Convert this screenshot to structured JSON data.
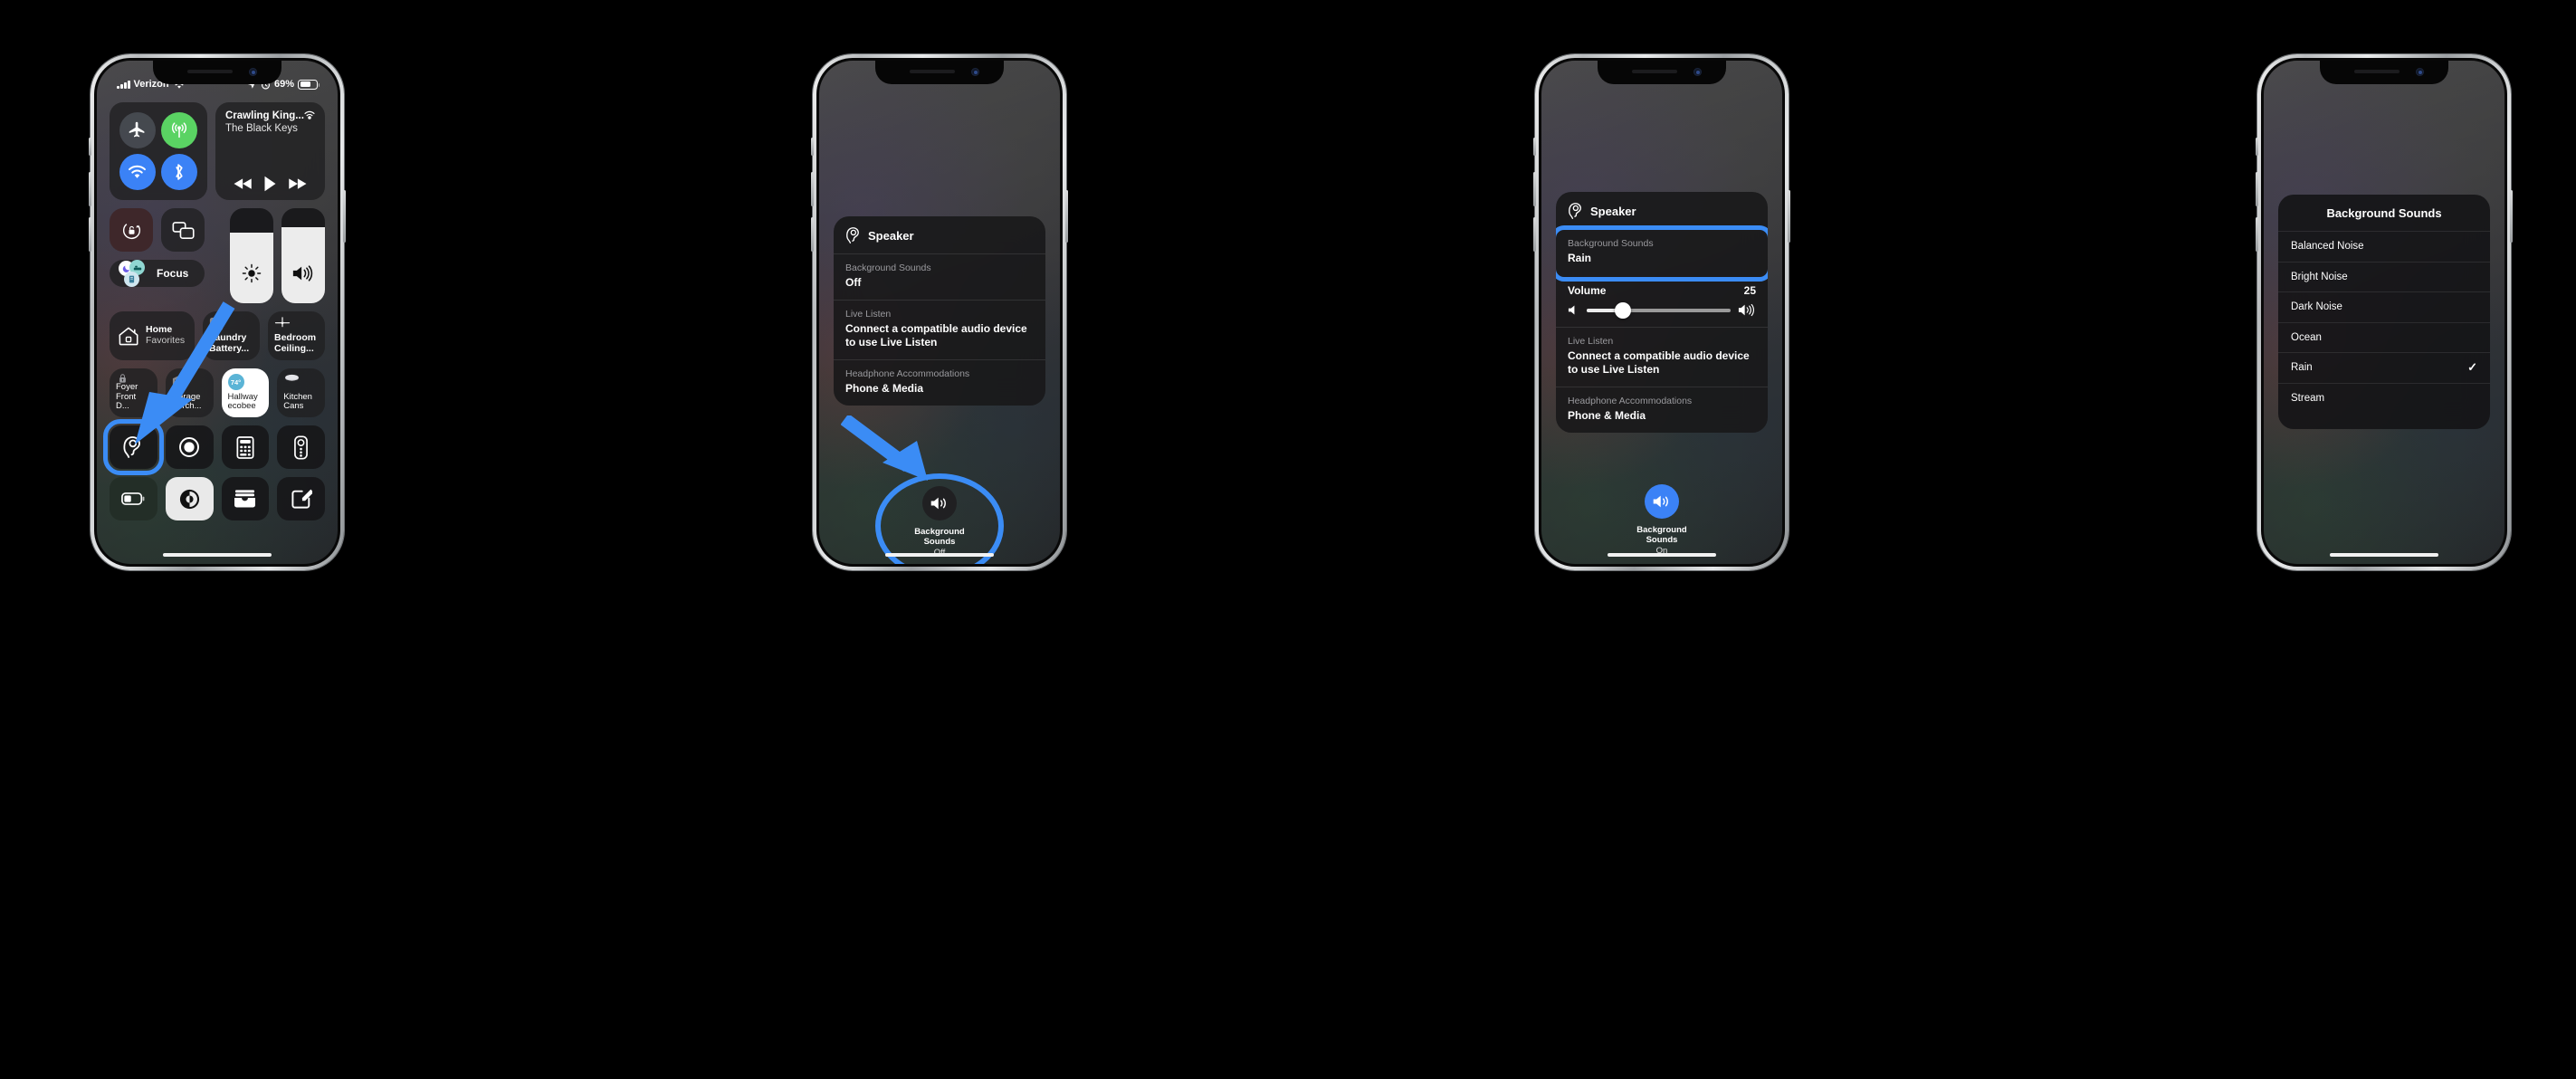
{
  "accent_blue": "#3b8cf5",
  "phone1": {
    "status_bar": {
      "carrier": "Verizon",
      "battery_percent": "69%",
      "icons": [
        "signal-bars-icon",
        "wifi-icon",
        "location-arrow-icon",
        "alarm-clock-icon",
        "battery-icon"
      ]
    },
    "connectivity": {
      "airplane_mode": "airplane-icon",
      "cellular_data": "cellular-data-icon",
      "wifi": "wifi-icon",
      "bluetooth": "bluetooth-icon"
    },
    "now_playing": {
      "title": "Crawling King...",
      "artist": "The Black Keys",
      "airplay": "airplay-audio-icon",
      "controls": [
        "rewind-icon",
        "play-icon",
        "fast-forward-icon"
      ]
    },
    "toggles": {
      "rotation_lock": "rotation-lock-icon",
      "screen_mirroring": "screen-mirroring-icon",
      "focus_label": "Focus",
      "brightness": "brightness-icon",
      "volume": "volume-icon"
    },
    "home_tiles": [
      {
        "title": "Home",
        "subtitle": "Favorites",
        "icon": "home-icon"
      },
      {
        "title": "Laundry",
        "subtitle": "Battery...",
        "icon": "outlet-icon"
      },
      {
        "title": "Bedroom",
        "subtitle": "Ceiling...",
        "icon": "ceiling-fan-icon"
      }
    ],
    "accessories": [
      {
        "name_line1": "Foyer",
        "name_line2": "Front D...",
        "icon": "lock-icon",
        "lit": false
      },
      {
        "name_line1": "Garage",
        "name_line2": "Perch...",
        "icon": "garage-door-icon",
        "lit": false
      },
      {
        "name_line1": "Hallway",
        "name_line2": "ecobee",
        "icon": "thermostat-icon",
        "lit": true,
        "temperature": "74°"
      },
      {
        "name_line1": "Kitchen",
        "name_line2": "Cans",
        "icon": "ceiling-light-icon",
        "lit": false
      }
    ],
    "tiles_row1": [
      {
        "icon": "hearing-ear-icon",
        "highlighted": true
      },
      {
        "icon": "screen-record-icon",
        "highlighted": false
      },
      {
        "icon": "calculator-icon",
        "highlighted": false
      },
      {
        "icon": "apple-tv-remote-icon",
        "highlighted": false
      }
    ],
    "tiles_row2": [
      {
        "icon": "low-power-mode-icon",
        "style": "greenish"
      },
      {
        "icon": "dark-mode-icon",
        "style": "white"
      },
      {
        "icon": "wallet-icon",
        "style": "dark"
      },
      {
        "icon": "notes-icon",
        "style": "dark"
      }
    ],
    "annotation": {
      "arrow": "arrow-pointing-to-hearing-tile"
    }
  },
  "phone2": {
    "panel": {
      "header_icon": "hearing-ear-icon",
      "header_title": "Speaker",
      "rows": [
        {
          "label": "Background Sounds",
          "value": "Off",
          "highlighted": false
        },
        {
          "label": "Live Listen",
          "value": "Connect a compatible audio device to use Live Listen",
          "highlighted": false
        },
        {
          "label": "Headphone Accommodations",
          "value": "Phone & Media",
          "highlighted": false
        }
      ]
    },
    "bottom_control": {
      "icon": "speaker-waves-icon",
      "caption_line1": "Background",
      "caption_line2": "Sounds",
      "state": "Off",
      "highlighted": true,
      "knob_style": "dark"
    },
    "annotation": {
      "arrow": "arrow-pointing-to-background-sounds-button"
    }
  },
  "phone3": {
    "panel": {
      "header_icon": "hearing-ear-icon",
      "header_title": "Speaker",
      "rows": [
        {
          "label": "Background Sounds",
          "value": "Rain",
          "highlighted": true
        },
        {
          "label": "Live Listen",
          "value": "Connect a compatible audio device to use Live Listen",
          "highlighted": false
        },
        {
          "label": "Headphone Accommodations",
          "value": "Phone & Media",
          "highlighted": false
        }
      ],
      "volume": {
        "label": "Volume",
        "value": "25",
        "percent": 25,
        "icon_low": "speaker-low-icon",
        "icon_high": "speaker-high-icon"
      }
    },
    "bottom_control": {
      "icon": "speaker-waves-icon",
      "caption_line1": "Background",
      "caption_line2": "Sounds",
      "state": "On",
      "highlighted": false,
      "knob_style": "on"
    }
  },
  "phone4": {
    "list": {
      "title": "Background Sounds",
      "items": [
        {
          "name": "Balanced Noise",
          "selected": false
        },
        {
          "name": "Bright Noise",
          "selected": false
        },
        {
          "name": "Dark Noise",
          "selected": false
        },
        {
          "name": "Ocean",
          "selected": false
        },
        {
          "name": "Rain",
          "selected": true
        },
        {
          "name": "Stream",
          "selected": false
        }
      ],
      "checkmark": "✓"
    }
  }
}
